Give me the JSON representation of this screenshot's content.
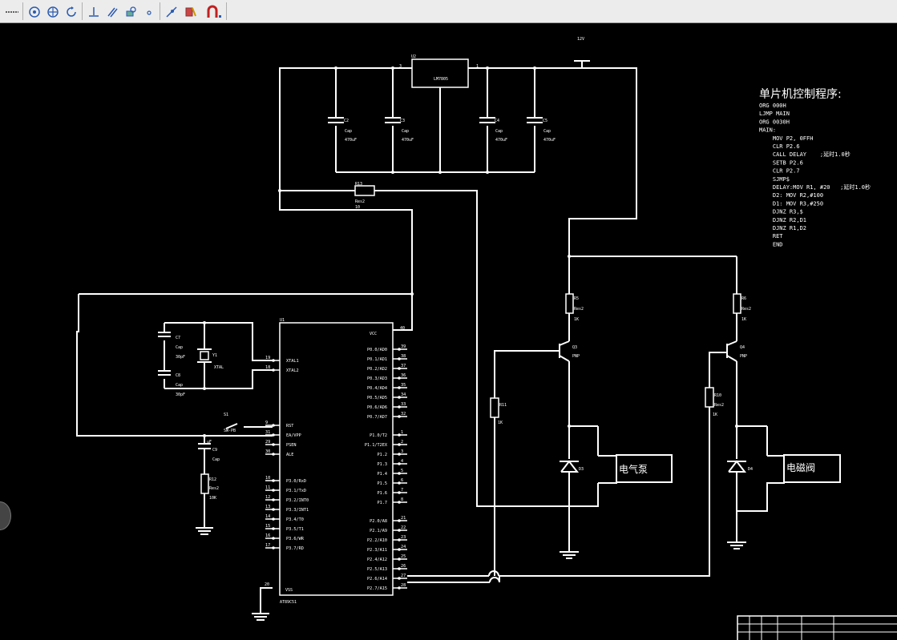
{
  "toolbar": {
    "buttons": [
      {
        "name": "line-style-icon"
      },
      {
        "name": "zoom-circle-icon"
      },
      {
        "name": "zoom-pan-icon"
      },
      {
        "name": "rotate-icon"
      },
      {
        "name": "junction-icon"
      },
      {
        "name": "bus-icon"
      },
      {
        "name": "component-place-icon"
      },
      {
        "name": "dot-icon"
      },
      {
        "name": "probe-icon"
      },
      {
        "name": "paint-icon"
      },
      {
        "name": "magnet-icon"
      }
    ]
  },
  "schematic": {
    "power_label": "12V",
    "regulator": {
      "ref": "U2",
      "part": "LM7805",
      "pin_in": "3",
      "pin_out": "1"
    },
    "capacitors": [
      {
        "ref": "C2",
        "type": "Cap",
        "value": "470uF"
      },
      {
        "ref": "C3",
        "type": "Cap",
        "value": "470uF"
      },
      {
        "ref": "C4",
        "type": "Cap",
        "value": "470uF"
      },
      {
        "ref": "C5",
        "type": "Cap",
        "value": "470uF"
      },
      {
        "ref": "C7",
        "type": "Cap",
        "value": "30pF"
      },
      {
        "ref": "C8",
        "type": "Cap",
        "value": "30pF"
      },
      {
        "ref": "C9",
        "type": "Cap",
        "value": "uF"
      }
    ],
    "r13": {
      "ref": "R13",
      "type": "Res2",
      "value": "10"
    },
    "r12": {
      "ref": "R12",
      "type": "Res2",
      "value": "10K"
    },
    "crystal": {
      "ref": "Y1",
      "type": "XTAL"
    },
    "switch": {
      "ref": "S1",
      "type": "SW-PB"
    },
    "mcu": {
      "ref": "U1",
      "part": "AT89C51",
      "vcc": "VCC",
      "vss": "VSS",
      "vcc_pin": "40",
      "vss_pin": "20",
      "left_pins": [
        {
          "n": "19",
          "label": "XTAL1"
        },
        {
          "n": "18",
          "label": "XTAL2"
        },
        {
          "n": "9",
          "label": "RST"
        },
        {
          "n": "31",
          "label": "EA/VPP"
        },
        {
          "n": "29",
          "label": "PSEN"
        },
        {
          "n": "30",
          "label": "ALE"
        },
        {
          "n": "10",
          "label": "P3.0/RxD"
        },
        {
          "n": "11",
          "label": "P3.1/TxD"
        },
        {
          "n": "12",
          "label": "P3.2/INT0"
        },
        {
          "n": "13",
          "label": "P3.3/INT1"
        },
        {
          "n": "14",
          "label": "P3.4/T0"
        },
        {
          "n": "15",
          "label": "P3.5/T1"
        },
        {
          "n": "16",
          "label": "P3.6/WR"
        },
        {
          "n": "17",
          "label": "P3.7/RD"
        }
      ],
      "right_pins": [
        {
          "n": "39",
          "label": "P0.0/AD0"
        },
        {
          "n": "38",
          "label": "P0.1/AD1"
        },
        {
          "n": "37",
          "label": "P0.2/AD2"
        },
        {
          "n": "36",
          "label": "P0.3/AD3"
        },
        {
          "n": "35",
          "label": "P0.4/AD4"
        },
        {
          "n": "34",
          "label": "P0.5/AD5"
        },
        {
          "n": "33",
          "label": "P0.6/AD6"
        },
        {
          "n": "32",
          "label": "P0.7/AD7"
        },
        {
          "n": "1",
          "label": "P1.0/T2"
        },
        {
          "n": "2",
          "label": "P1.1/T2EX"
        },
        {
          "n": "3",
          "label": "P1.2"
        },
        {
          "n": "4",
          "label": "P1.3"
        },
        {
          "n": "5",
          "label": "P1.4"
        },
        {
          "n": "6",
          "label": "P1.5"
        },
        {
          "n": "7",
          "label": "P1.6"
        },
        {
          "n": "8",
          "label": "P1.7"
        },
        {
          "n": "21",
          "label": "P2.0/A8"
        },
        {
          "n": "22",
          "label": "P2.1/A9"
        },
        {
          "n": "23",
          "label": "P2.2/A10"
        },
        {
          "n": "24",
          "label": "P2.3/A11"
        },
        {
          "n": "25",
          "label": "P2.4/A12"
        },
        {
          "n": "26",
          "label": "P2.5/A13"
        },
        {
          "n": "27",
          "label": "P2.6/A14"
        },
        {
          "n": "28",
          "label": "P2.7/A15"
        }
      ]
    },
    "drivers": [
      {
        "q_ref": "Q3",
        "q_type": "PNP",
        "r_col_ref": "R5",
        "r_col_type": "Res2",
        "r_col_value": "1K",
        "r_base_ref": "R11",
        "r_base_value": "1K",
        "diode_ref": "D3",
        "load": "电气泵"
      },
      {
        "q_ref": "Q4",
        "q_type": "PNP",
        "r_col_ref": "R6",
        "r_col_type": "Res2",
        "r_col_value": "1K",
        "r_base_ref": "R10",
        "r_base_type": "Res2",
        "r_base_value": "1K",
        "diode_ref": "D4",
        "load": "电磁阀"
      }
    ]
  },
  "program": {
    "title": "单片机控制程序:",
    "lines": [
      "ORG 000H",
      "LJMP MAIN",
      "ORG 0030H",
      "MAIN:",
      "    MOV P2, 0FFH",
      "    CLR P2.6",
      "    CALL DELAY    ;延时1.0秒",
      "    SETB P2.6",
      "    CLR P2.7",
      "    SJMP$",
      "    DELAY:MOV R1, #20   ;延时1.0秒",
      "    D2: MOV R2,#100",
      "    D1: MOV R3,#250",
      "    DJNZ R3,$",
      "    DJNZ R2,D1",
      "    DJNZ R1,D2",
      "    RET",
      "    END"
    ]
  }
}
